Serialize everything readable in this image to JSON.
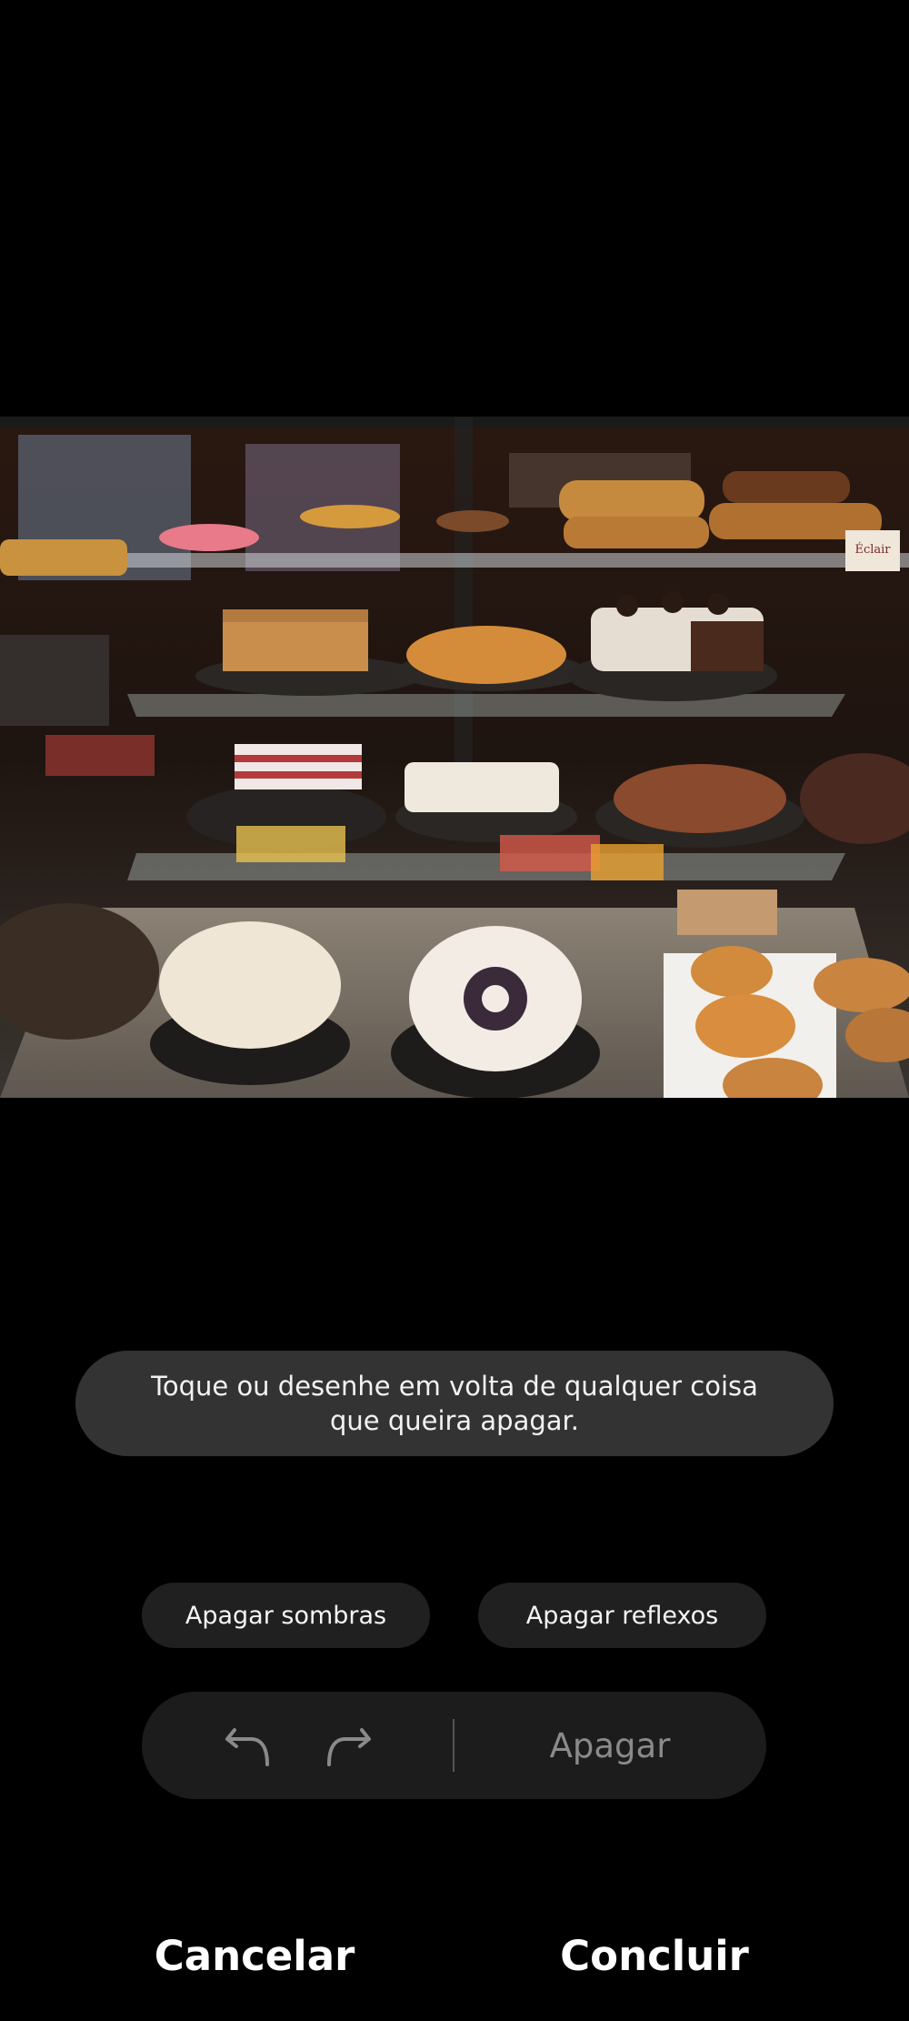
{
  "hint": {
    "text": "Toque ou desenhe em volta de qualquer coisa que queira apagar."
  },
  "options": {
    "shadows_label": "Apagar sombras",
    "reflections_label": "Apagar reflexos"
  },
  "toolbar": {
    "undo_icon": "undo-icon",
    "redo_icon": "redo-icon",
    "erase_label": "Apagar"
  },
  "actions": {
    "cancel_label": "Cancelar",
    "done_label": "Concluir"
  },
  "photo": {
    "sign_text": "Éclair"
  },
  "colors": {
    "background": "#000000",
    "bubble": "#333333",
    "pill": "#202020",
    "toolbar": "#1c1c1c",
    "disabled_text": "#8a8a8a"
  }
}
